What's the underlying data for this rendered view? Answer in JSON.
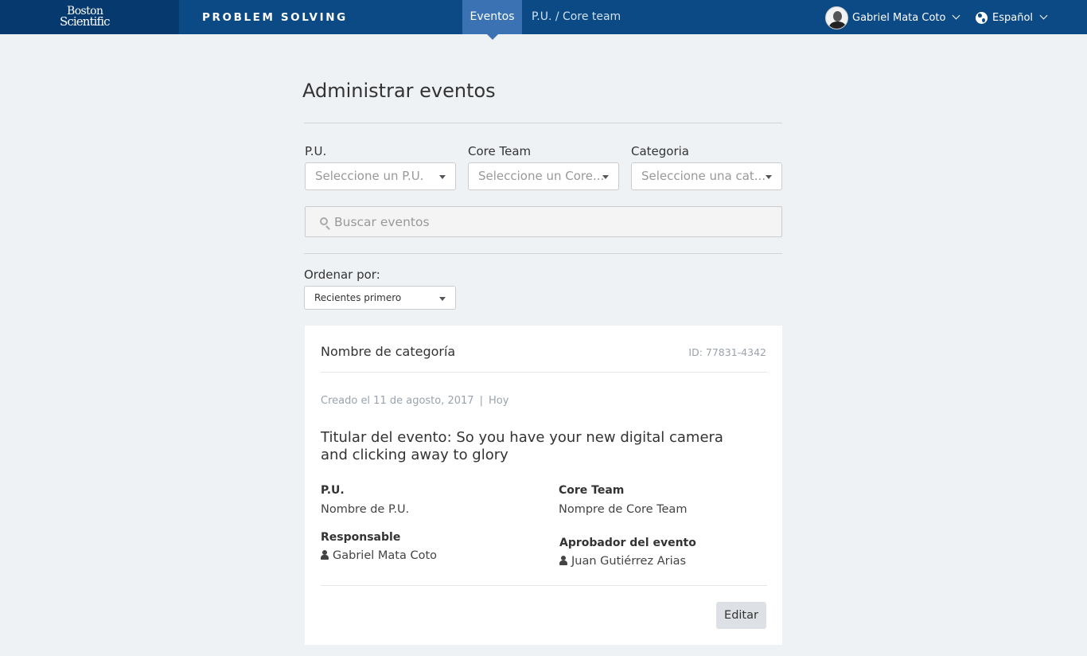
{
  "header": {
    "logo_line1": "Boston",
    "logo_line2": "Scientific",
    "app_title": "PROBLEM SOLVING",
    "tabs": [
      {
        "label": "Eventos",
        "active": true
      },
      {
        "label": "P.U. / Core team",
        "active": false
      }
    ],
    "user_name": "Gabriel Mata Coto",
    "language": "Español"
  },
  "main": {
    "title": "Administrar eventos",
    "filters": [
      {
        "label": "P.U.",
        "placeholder": "Seleccione un P.U."
      },
      {
        "label": "Core Team",
        "placeholder": "Seleccione un Core..."
      },
      {
        "label": "Categoria",
        "placeholder": "Seleccione una cat..."
      }
    ],
    "search_placeholder": "Buscar eventos",
    "sort": {
      "label": "Ordenar por:",
      "value": "Recientes primero"
    }
  },
  "event_card": {
    "category": "Nombre de categoría",
    "id": "ID: 77831-4342",
    "created": "Creado el 11 de agosto, 2017",
    "separator": "|",
    "when": "Hoy",
    "headline": "Titular del evento: So you have your new digital camera and clicking away to glory",
    "pu_label": "P.U.",
    "pu_value": "Nombre de P.U.",
    "core_label": "Core Team",
    "core_value": "Nompre de Core Team",
    "responsible_label": "Responsable",
    "responsible_value": "Gabriel Mata Coto",
    "approver_label": "Aprobador del evento",
    "approver_value": "Juan Gutiérrez Arias",
    "edit_label": "Editar"
  },
  "colors": {
    "header_bg": "#0b4a85",
    "logo_bg": "#063a6e",
    "active_tab": "#3a72b4",
    "page_bg": "#eff2f5"
  },
  "icons": [
    "user-avatar",
    "chevron-down-icon",
    "globe-icon",
    "search-icon",
    "person-icon",
    "caret-down-icon"
  ]
}
